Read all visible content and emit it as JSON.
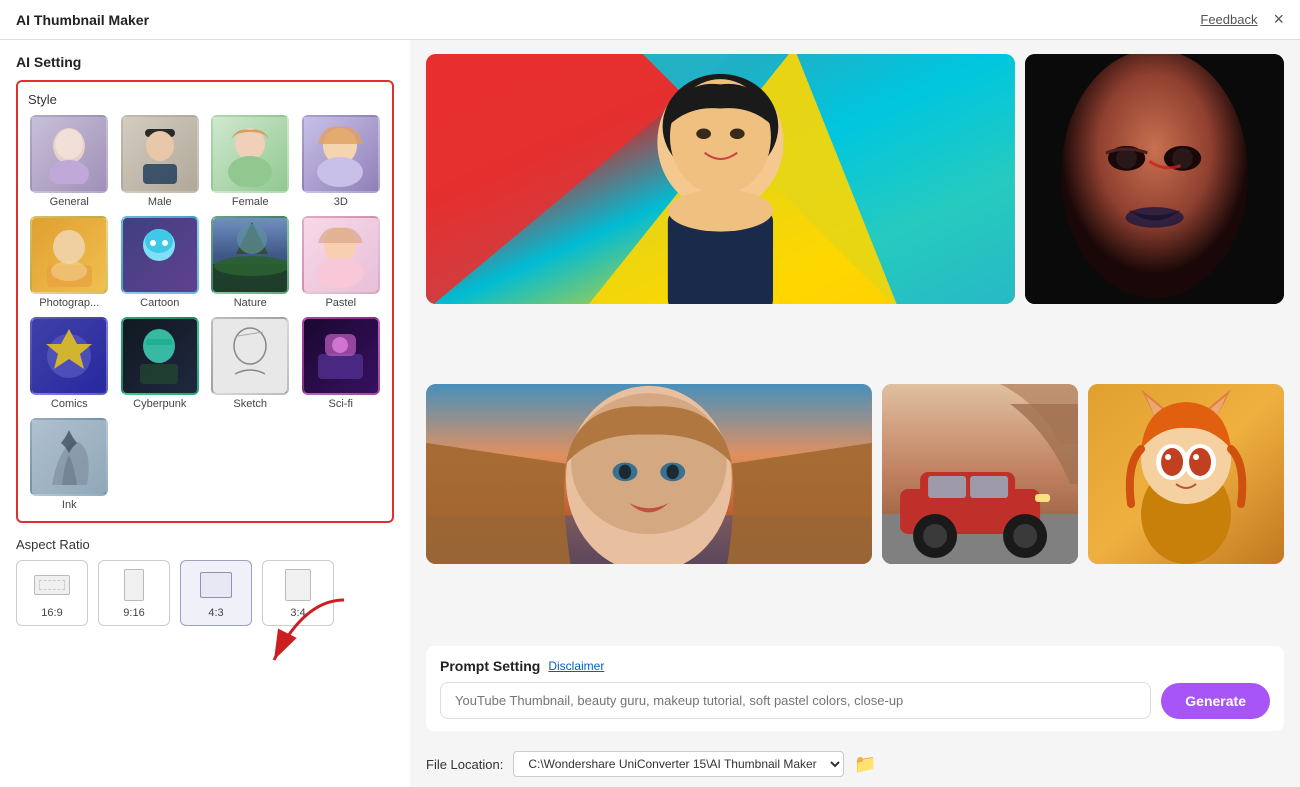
{
  "titleBar": {
    "title": "AI Thumbnail Maker",
    "feedbackLabel": "Feedback",
    "closeIcon": "×"
  },
  "aiSetting": {
    "label": "AI Setting"
  },
  "style": {
    "label": "Style",
    "items": [
      {
        "id": "general",
        "name": "General",
        "class": "thumb-general",
        "icon": "🧑‍🎨",
        "selected": false
      },
      {
        "id": "male",
        "name": "Male",
        "class": "thumb-male",
        "icon": "🧑",
        "selected": false
      },
      {
        "id": "female",
        "name": "Female",
        "class": "thumb-female",
        "icon": "👩",
        "selected": false
      },
      {
        "id": "3d",
        "name": "3D",
        "class": "thumb-3d",
        "icon": "🎮",
        "selected": false
      },
      {
        "id": "photography",
        "name": "Photograp...",
        "class": "thumb-photography",
        "icon": "📷",
        "selected": false
      },
      {
        "id": "cartoon",
        "name": "Cartoon",
        "class": "thumb-cartoon",
        "icon": "🎭",
        "selected": false
      },
      {
        "id": "nature",
        "name": "Nature",
        "class": "thumb-nature",
        "icon": "🌿",
        "selected": false
      },
      {
        "id": "pastel",
        "name": "Pastel",
        "class": "thumb-pastel",
        "icon": "🎨",
        "selected": false
      },
      {
        "id": "comics",
        "name": "Comics",
        "class": "thumb-comics",
        "icon": "💥",
        "selected": false
      },
      {
        "id": "cyberpunk",
        "name": "Cyberpunk",
        "class": "thumb-cyberpunk",
        "icon": "🤖",
        "selected": false
      },
      {
        "id": "sketch",
        "name": "Sketch",
        "class": "thumb-sketch",
        "icon": "✏️",
        "selected": false
      },
      {
        "id": "scifi",
        "name": "Sci-fi",
        "class": "thumb-scifi",
        "icon": "🚀",
        "selected": false
      },
      {
        "id": "ink",
        "name": "Ink",
        "class": "thumb-ink",
        "icon": "🖌️",
        "selected": false
      }
    ]
  },
  "aspectRatio": {
    "label": "Aspect Ratio",
    "items": [
      {
        "id": "16-9",
        "name": "16:9",
        "selected": false
      },
      {
        "id": "9-16",
        "name": "9:16",
        "selected": false
      },
      {
        "id": "4-3",
        "name": "4:3",
        "selected": true
      },
      {
        "id": "3-4",
        "name": "3:4",
        "selected": false
      }
    ]
  },
  "promptSetting": {
    "label": "Prompt Setting",
    "disclaimerLabel": "Disclaimer",
    "placeholder": "YouTube Thumbnail, beauty guru, makeup tutorial, soft pastel colors, close-up",
    "generateLabel": "Generate"
  },
  "fileLocation": {
    "label": "File Location:",
    "path": "C:\\Wondershare UniConverter 15\\AI Thumbnail Maker",
    "folderIcon": "📁"
  }
}
